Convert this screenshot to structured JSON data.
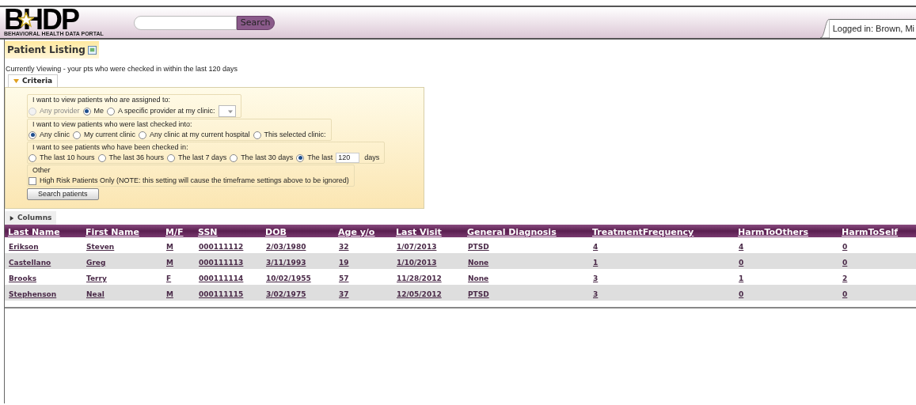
{
  "header": {
    "logo": {
      "letters": "BHDP",
      "subtitle": "BEHAVIORAL HEALTH DATA PORTAL"
    },
    "search": {
      "button": "Search"
    },
    "user": "Logged in: Brown, Mi"
  },
  "page_title": "Patient Listing",
  "viewing_note": "Currently Viewing - your pts who were checked in within the last 120 days",
  "criteria": {
    "label": "Criteria",
    "expanded": true,
    "groups": [
      {
        "legend": "I want to view patients who are assigned to:",
        "dropdown": true,
        "options": [
          {
            "label": "Any provider",
            "selected": false,
            "disabled": true
          },
          {
            "label": "Me",
            "selected": true,
            "disabled": false
          },
          {
            "label": "A specific provider at my clinic:",
            "selected": false,
            "disabled": false
          }
        ]
      },
      {
        "legend": "I want to view patients who were last checked into:",
        "dropdown": false,
        "options": [
          {
            "label": "Any clinic",
            "selected": true,
            "disabled": false
          },
          {
            "label": "My current clinic",
            "selected": false,
            "disabled": false
          },
          {
            "label": "Any clinic at my current hospital",
            "selected": false,
            "disabled": false
          },
          {
            "label": "This selected clinic:",
            "selected": false,
            "disabled": false
          }
        ]
      },
      {
        "legend": "I want to see patients who have been checked in:",
        "dropdown": false,
        "options": [
          {
            "label": "The last 10 hours",
            "selected": false,
            "disabled": false
          },
          {
            "label": "The last 36 hours",
            "selected": false,
            "disabled": false
          },
          {
            "label": "The last 7 days",
            "selected": false,
            "disabled": false
          },
          {
            "label": "The last 30 days",
            "selected": false,
            "disabled": false
          },
          {
            "label": "The last",
            "selected": true,
            "disabled": false,
            "value": "120",
            "suffix": "days"
          }
        ]
      }
    ],
    "other": {
      "legend": "Other",
      "checkbox": {
        "label": "High Risk Patients Only (NOTE: this setting will cause the timeframe settings above to be ignored)",
        "checked": false
      }
    },
    "button": "Search patients"
  },
  "columns_toggle": {
    "label": "Columns",
    "expanded": false
  },
  "table": {
    "columns": [
      "Last Name",
      "First Name",
      "M/F",
      "SSN",
      "DOB",
      "Age y/o",
      "Last Visit",
      "General Diagnosis",
      "TreatmentFrequency",
      "HarmToOthers",
      "HarmToSelf"
    ],
    "rows": [
      [
        "Erikson",
        "Steven",
        "M",
        "000111112",
        "2/03/1980",
        "32",
        "1/07/2013",
        "PTSD",
        "4",
        "4",
        "0"
      ],
      [
        "Castellano",
        "Greg",
        "M",
        "000111113",
        "3/11/1993",
        "19",
        "1/10/2013",
        "None",
        "1",
        "0",
        "0"
      ],
      [
        "Brooks",
        "Terry",
        "F",
        "000111114",
        "10/02/1955",
        "57",
        "11/28/2012",
        "None",
        "3",
        "1",
        "2"
      ],
      [
        "Stephenson",
        "Neal",
        "M",
        "000111115",
        "3/02/1975",
        "37",
        "12/05/2012",
        "PTSD",
        "3",
        "0",
        "0"
      ]
    ]
  }
}
